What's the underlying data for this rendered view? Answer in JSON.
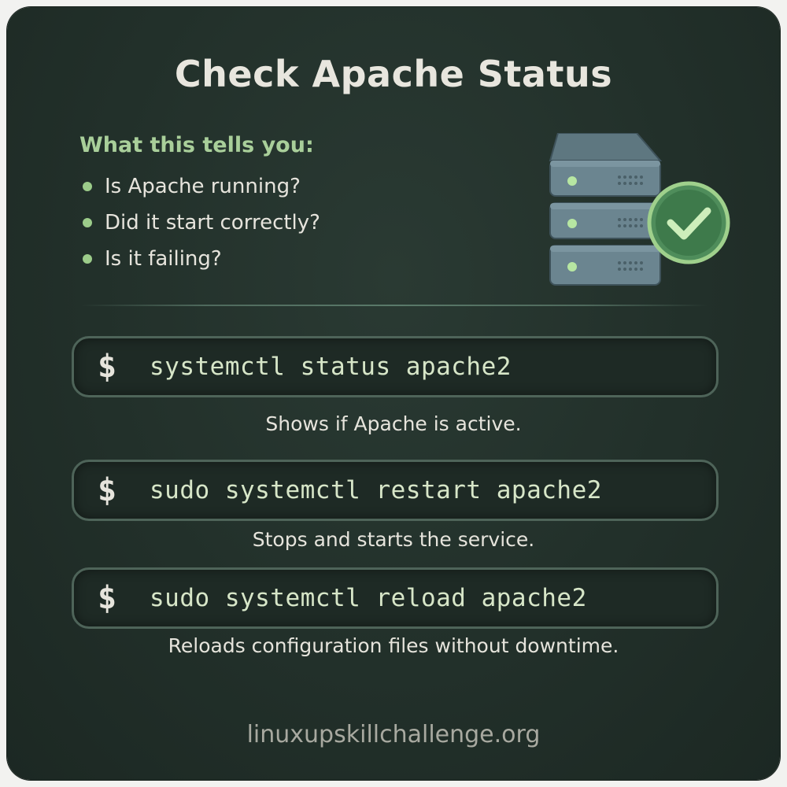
{
  "title": "Check Apache Status",
  "info": {
    "heading": "What this tells you:",
    "bullets": [
      "Is Apache running?",
      "Did it start correctly?",
      "Is it failing?"
    ]
  },
  "commands": [
    {
      "prompt": "$",
      "command": "systemctl status apache2",
      "description": "Shows if Apache is active."
    },
    {
      "prompt": "$",
      "command": "sudo systemctl restart apache2",
      "description": "Stops and starts the service."
    },
    {
      "prompt": "$",
      "command": "sudo systemctl reload apache2",
      "description": "Reloads configuration files without downtime."
    }
  ],
  "footer": "linuxupskillchallenge.org",
  "icons": {
    "server": "server-icon",
    "check": "checkmark-icon"
  },
  "colors": {
    "background": "#22302a",
    "accent_green": "#a9cf9a",
    "text": "#e6e4dc",
    "command_text": "#d7e6c8",
    "box_border": "#4e6459",
    "footer_text": "#a8a9a0"
  }
}
